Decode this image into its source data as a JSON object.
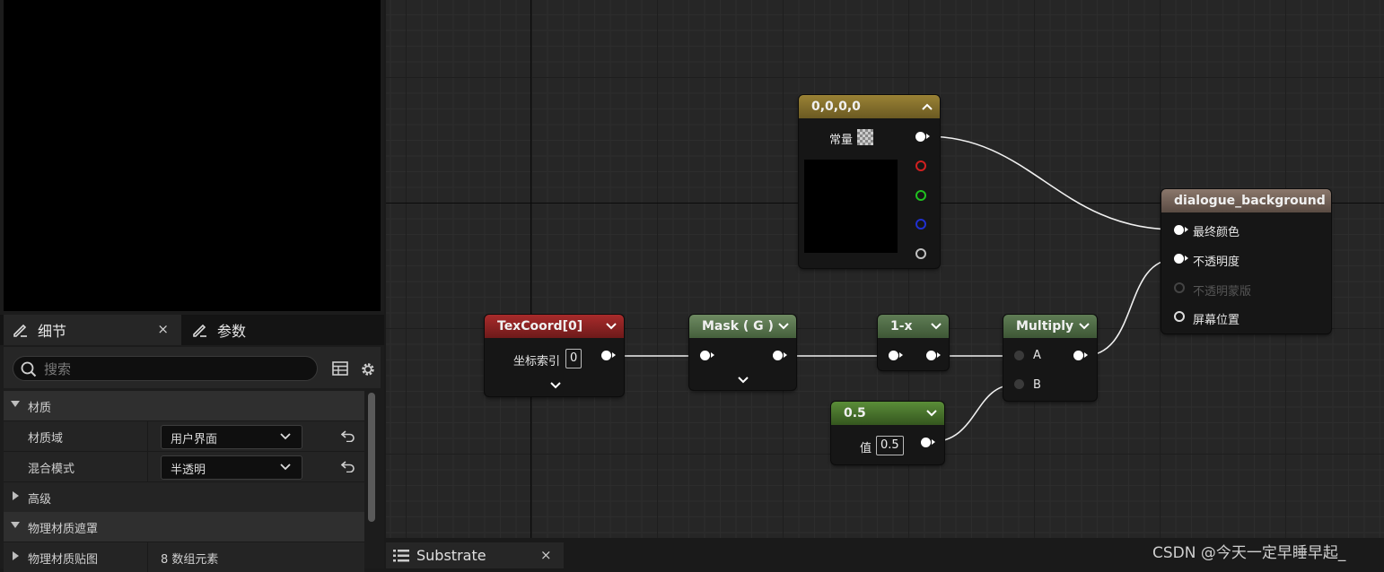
{
  "left_panel": {
    "tabs": [
      {
        "label": "细节",
        "close": "×"
      },
      {
        "label": "参数"
      }
    ],
    "search": {
      "placeholder": "搜索"
    },
    "properties": {
      "cat_material": "材质",
      "domain_label": "材质域",
      "domain_value": "用户界面",
      "blend_label": "混合模式",
      "blend_value": "半透明",
      "cat_advanced": "高级",
      "cat_physmask": "物理材质遮罩",
      "physmap_label": "物理材质贴图",
      "physmap_value": "8 数组元素"
    }
  },
  "graph": {
    "const4": {
      "title": "0,0,0,0",
      "label": "常量"
    },
    "texcoord": {
      "title": "TexCoord[0]",
      "label": "坐标索引",
      "value": "0"
    },
    "mask": {
      "title": "Mask ( G )"
    },
    "oneminus": {
      "title": "1-x"
    },
    "multiply": {
      "title": "Multiply",
      "pin_a": "A",
      "pin_b": "B"
    },
    "const1": {
      "title": "0.5",
      "label": "值",
      "value": "0.5"
    },
    "result": {
      "title": "dialogue_background",
      "pins": [
        "最终颜色",
        "不透明度",
        "不透明蒙版",
        "屏幕位置"
      ]
    }
  },
  "bottom_tab": {
    "label": "Substrate",
    "close": "×"
  },
  "watermark": "CSDN @今天一定早睡早起_",
  "colors": {
    "const4_header": "#8a7530",
    "texcoord_header": "#8a2323",
    "mask_header": "#5f7d55",
    "oneminus_header": "#4f6b46",
    "multiply_header": "#4f6b46",
    "const1_header": "#4d7a32",
    "result_header": "#6e5e54",
    "wire": "#ffffff"
  }
}
